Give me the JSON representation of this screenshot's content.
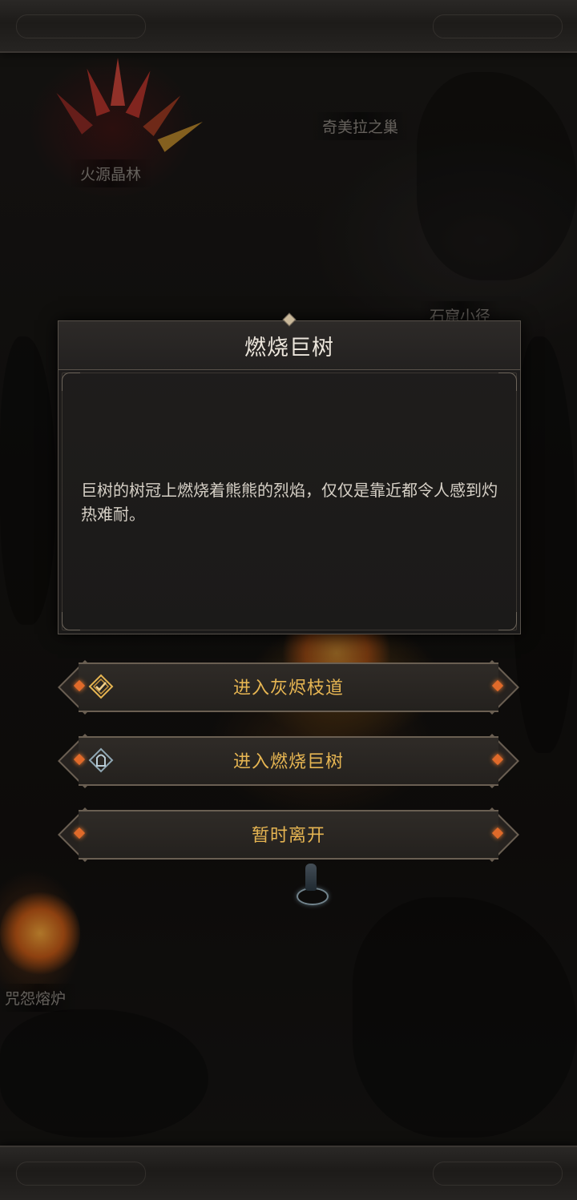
{
  "map": {
    "labels": {
      "fire_crystal_forest": "火源晶林",
      "chimera_nest": "奇美拉之巢",
      "stone_cave_path": "石窟小径",
      "cursed_furnace": "咒怨熔炉"
    }
  },
  "dialog": {
    "title": "燃烧巨树",
    "description": "巨树的树冠上燃烧着熊熊的烈焰，仅仅是靠近都令人感到灼热难耐。"
  },
  "options": [
    {
      "label": "进入灰烬枝道",
      "icon": "quest-check-icon"
    },
    {
      "label": "进入燃烧巨树",
      "icon": "gate-icon"
    },
    {
      "label": "暂时离开",
      "icon": ""
    }
  ],
  "colors": {
    "button_text": "#e6b552",
    "accent_gem": "#e06a2a",
    "title_text": "#ece6dc"
  }
}
